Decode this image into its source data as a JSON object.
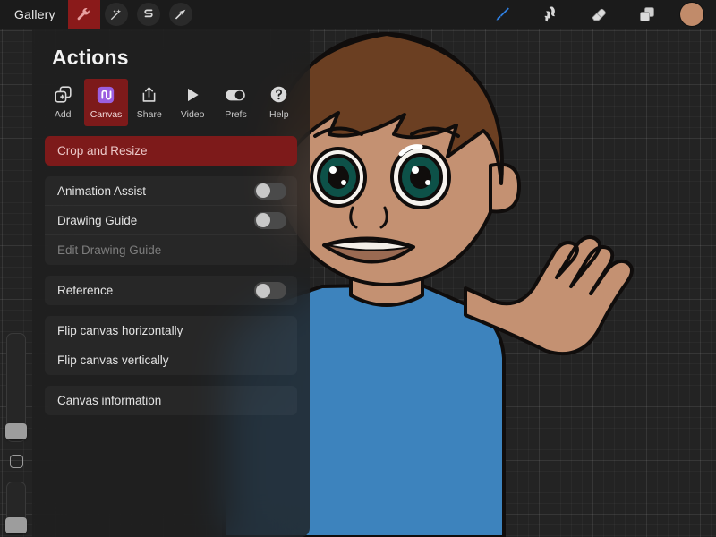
{
  "topbar": {
    "gallery_label": "Gallery",
    "tools": [
      {
        "name": "wrench-icon",
        "label": "Actions",
        "active": true
      },
      {
        "name": "magic-wand-icon",
        "label": "Adjustments",
        "active": false
      },
      {
        "name": "selection-icon",
        "label": "Selection",
        "active": false
      },
      {
        "name": "transform-icon",
        "label": "Transform",
        "active": false
      }
    ],
    "right_tools": [
      {
        "name": "paintbrush-icon",
        "label": "Paint"
      },
      {
        "name": "smudge-icon",
        "label": "Smudge"
      },
      {
        "name": "eraser-icon",
        "label": "Erase"
      },
      {
        "name": "layers-icon",
        "label": "Layers"
      }
    ],
    "color_swatch": {
      "name": "color-swatch",
      "label": "Color",
      "color": "#c18b6a"
    }
  },
  "sidebar": {
    "brush_size_label": "Brush size",
    "modify_label": "Modify",
    "brush_opacity_label": "Brush opacity"
  },
  "panel": {
    "title": "Actions",
    "tabs": [
      {
        "label": "Add",
        "icon": "add-icon",
        "active": false
      },
      {
        "label": "Canvas",
        "icon": "canvas-icon",
        "active": true
      },
      {
        "label": "Share",
        "icon": "share-icon",
        "active": false
      },
      {
        "label": "Video",
        "icon": "video-icon",
        "active": false
      },
      {
        "label": "Prefs",
        "icon": "prefs-icon",
        "active": false
      },
      {
        "label": "Help",
        "icon": "help-icon",
        "active": false
      }
    ],
    "groups": [
      {
        "rows": [
          {
            "label": "Crop and Resize",
            "type": "action",
            "state": "highlight"
          }
        ]
      },
      {
        "rows": [
          {
            "label": "Animation Assist",
            "type": "toggle",
            "value": "off"
          },
          {
            "label": "Drawing Guide",
            "type": "toggle",
            "value": "off"
          },
          {
            "label": "Edit Drawing Guide",
            "type": "action",
            "state": "disabled"
          }
        ]
      },
      {
        "rows": [
          {
            "label": "Reference",
            "type": "toggle",
            "value": "off"
          }
        ]
      },
      {
        "rows": [
          {
            "label": "Flip canvas horizontally",
            "type": "action",
            "state": "normal"
          },
          {
            "label": "Flip canvas vertically",
            "type": "action",
            "state": "normal"
          }
        ]
      },
      {
        "rows": [
          {
            "label": "Canvas information",
            "type": "action",
            "state": "normal"
          }
        ]
      }
    ]
  },
  "artwork": {
    "name": "cartoon-boy-waving",
    "colors": {
      "skin": "#c49172",
      "hair": "#6b3f22",
      "shirt": "#3d83bd",
      "eye": "#0d5148",
      "outline": "#100d0c",
      "mouth": "#9a6a52",
      "teeth": "#f4efe8",
      "background": "#232323"
    }
  }
}
